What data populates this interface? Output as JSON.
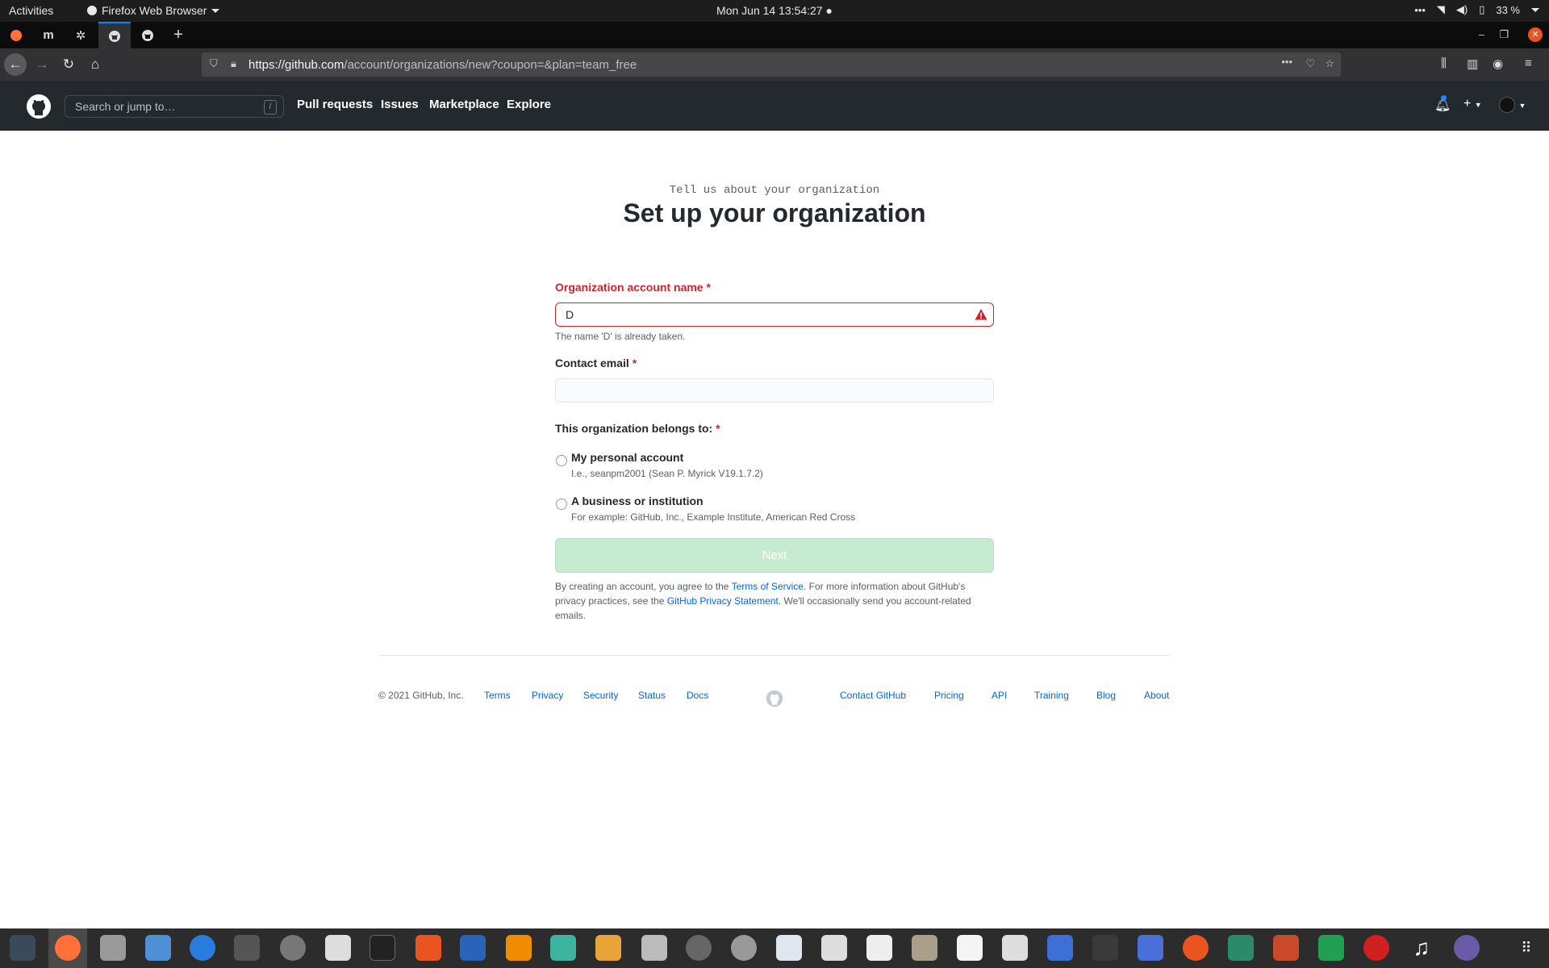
{
  "system": {
    "activities": "Activities",
    "app_name": "Firefox Web Browser",
    "clock": "Mon Jun 14  13:54:27",
    "battery": "33 %"
  },
  "browser": {
    "url_host": "https://github.com",
    "url_path": "/account/organizations/new?coupon=&plan=team_free",
    "tabs": [
      "firefox-icon",
      "m-icon",
      "gear-icon",
      "github-icon",
      "github-icon"
    ]
  },
  "github_header": {
    "search_placeholder": "Search or jump to…",
    "search_shortcut": "/",
    "nav": [
      "Pull requests",
      "Issues",
      "Marketplace",
      "Explore"
    ]
  },
  "page": {
    "subtitle": "Tell us about your organization",
    "title": "Set up your organization"
  },
  "form": {
    "org_name_label": "Organization account name",
    "org_name_value": "D",
    "org_name_error": "The name 'D' is already taken.",
    "email_label": "Contact email",
    "email_value": "",
    "belongs_label": "This organization belongs to:",
    "required_mark": "*",
    "options": [
      {
        "label": "My personal account",
        "note": "I.e., seanpm2001 (Sean P. Myrick V19.1.7.2)",
        "selected": false
      },
      {
        "label": "A business or institution",
        "note": "For example: GitHub, Inc., Example Institute, American Red Cross",
        "selected": false
      }
    ],
    "next_label": "Next",
    "terms": {
      "part1": "By creating an account, you agree to the ",
      "tos_link": "Terms of Service",
      "part2": ". For more information about GitHub's privacy practices, see the ",
      "privacy_link": "GitHub Privacy Statement",
      "part3": ". We'll occasionally send you account-related emails."
    }
  },
  "footer": {
    "copyright": "© 2021 GitHub, Inc.",
    "left_links": [
      "Terms",
      "Privacy",
      "Security",
      "Status",
      "Docs"
    ],
    "right_links": [
      "Contact GitHub",
      "Pricing",
      "API",
      "Training",
      "Blog",
      "About"
    ]
  },
  "colors": {
    "error": "#cb2431",
    "link": "#0366d6",
    "gh_header": "#24292e",
    "next_disabled": "#c6ebd0"
  }
}
